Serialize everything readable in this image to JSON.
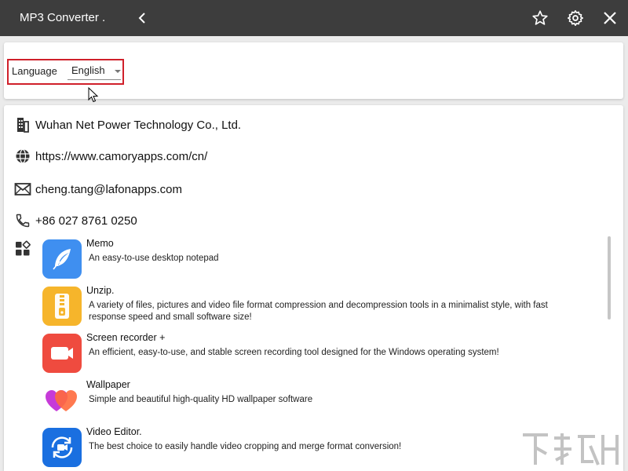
{
  "app": {
    "title": "MP3 Converter ."
  },
  "language": {
    "label": "Language",
    "value": "English"
  },
  "company": {
    "name": "Wuhan Net Power Technology Co., Ltd.",
    "website": "https://www.camoryapps.com/cn/",
    "email": "cheng.tang@lafonapps.com",
    "phone": "+86 027 8761 0250"
  },
  "apps": [
    {
      "name": "Memo",
      "desc": "An easy-to-use desktop notepad",
      "color": "#3f8ff0"
    },
    {
      "name": "Unzip.",
      "desc": "A variety of files, pictures and video file format compression and decompression tools in a minimalist style, with fast response speed and small software size!",
      "color": "#f6b52b"
    },
    {
      "name": "Screen recorder +",
      "desc": "An efficient, easy-to-use, and stable screen recording tool designed for the Windows operating system!",
      "color": "#ef4b3f"
    },
    {
      "name": "Wallpaper",
      "desc": "Simple and beautiful high-quality HD wallpaper software",
      "color": "#d93bd0"
    },
    {
      "name": "Video Editor.",
      "desc": "The best choice to easily handle video cropping and merge format conversion!",
      "color": "#1a6fe0"
    }
  ],
  "colors": {
    "titlebar": "#3d3d3d",
    "highlight": "#d0202a"
  },
  "icons": [
    "back-icon",
    "star-icon",
    "gear-icon",
    "close-icon",
    "building-icon",
    "globe-icon",
    "mail-icon",
    "phone-icon",
    "apps-grid-icon"
  ]
}
